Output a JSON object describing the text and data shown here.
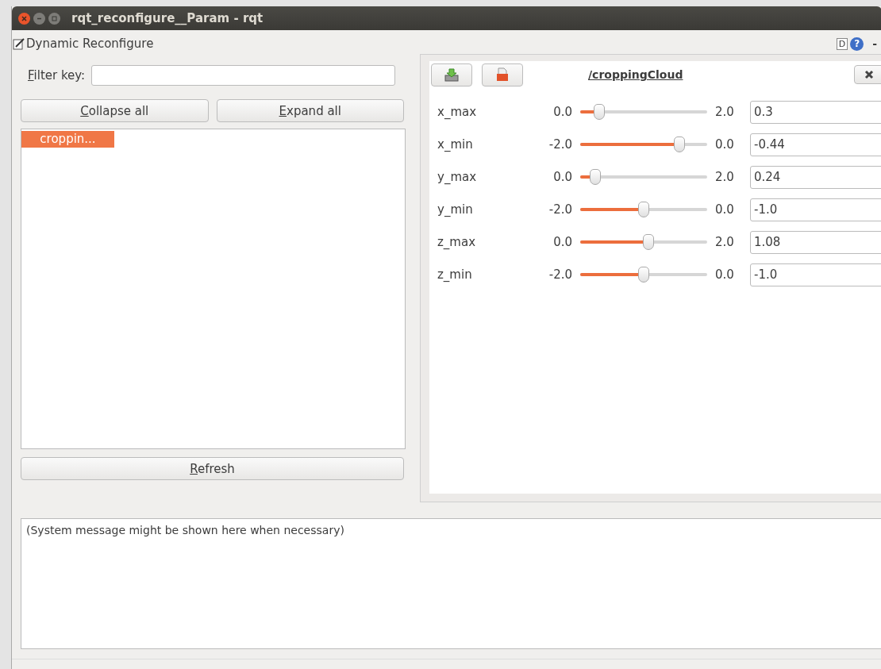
{
  "window": {
    "title": "rqt_reconfigure__Param - rqt"
  },
  "plugin": {
    "title": "Dynamic Reconfigure",
    "badge": "D",
    "help": "?",
    "minimize": "-"
  },
  "filter": {
    "label": "Filter key:",
    "mnemonic": true
  },
  "buttons": [
    {
      "label": "Collapse all",
      "mnemonic": true
    },
    {
      "label": "Expand all",
      "mnemonic": true
    }
  ],
  "tree": {
    "items": [
      {
        "label": "croppin...",
        "selected": true
      }
    ]
  },
  "refresh": {
    "label": "Refresh",
    "mnemonic": true
  },
  "node": {
    "title": "/croppingCloud",
    "params": [
      {
        "name": "x_max",
        "min": "0.0",
        "max": "2.0",
        "level": 0.15,
        "value": "0.3"
      },
      {
        "name": "x_min",
        "min": "-2.0",
        "max": "0.0",
        "level": 0.78,
        "value": "-0.44"
      },
      {
        "name": "y_max",
        "min": "0.0",
        "max": "2.0",
        "level": 0.12,
        "value": "0.24"
      },
      {
        "name": "y_min",
        "min": "-2.0",
        "max": "0.0",
        "level": 0.5,
        "value": "-1.0"
      },
      {
        "name": "z_max",
        "min": "0.0",
        "max": "2.0",
        "level": 0.54,
        "value": "1.08"
      },
      {
        "name": "z_min",
        "min": "-2.0",
        "max": "0.0",
        "level": 0.5,
        "value": "-1.0"
      }
    ]
  },
  "messages": {
    "text": "(System message might be shown here when necessary)"
  }
}
